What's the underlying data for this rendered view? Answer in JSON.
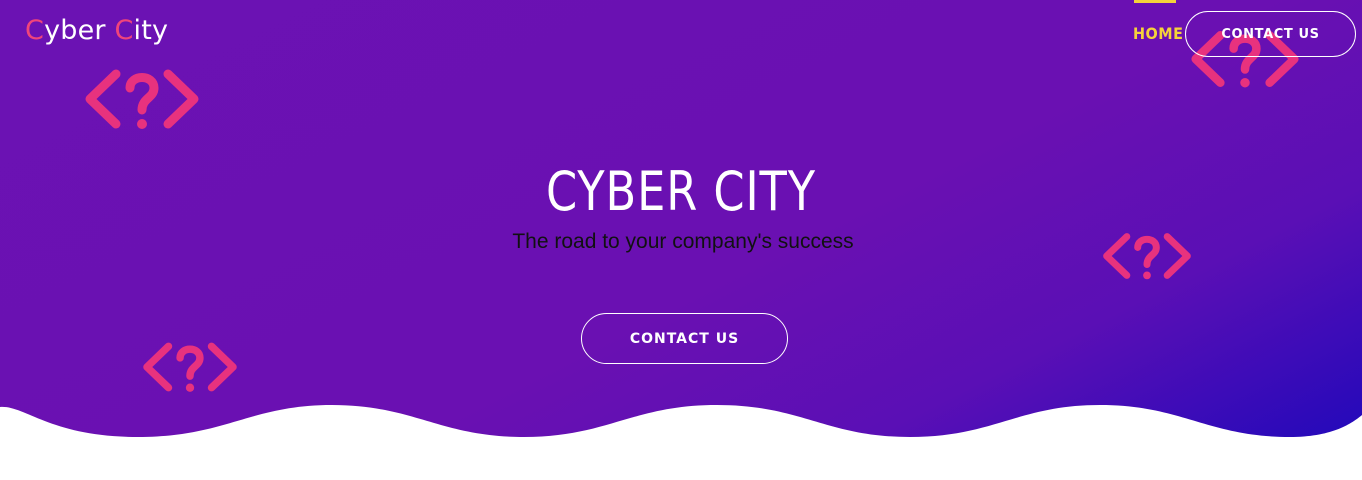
{
  "header": {
    "logo": {
      "first_initial": "C",
      "first_rest": "yber ",
      "second_initial": "C",
      "second_rest": "ity"
    },
    "nav": {
      "home_label": "HOME",
      "contact_label": "CONTACT US"
    }
  },
  "hero": {
    "title": "CYBER CITY",
    "subtitle": "The road to your company's success",
    "cta_label": "CONTACT US"
  },
  "decor": {
    "icon": "code-question-icon",
    "icon_color": "#e8327e"
  },
  "colors": {
    "gradient_start": "#6b12b3",
    "gradient_end": "#1a08bb",
    "nav_active": "#f5d23a",
    "logo_accent": "#f0457a"
  }
}
